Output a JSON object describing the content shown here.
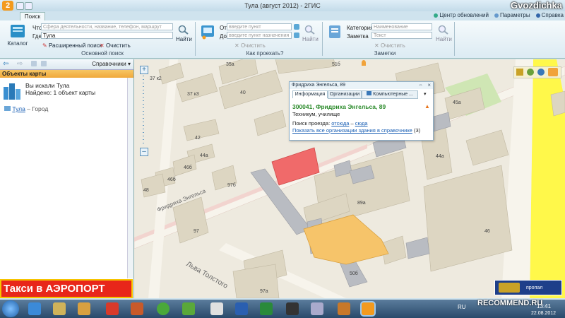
{
  "window": {
    "title": "Тула (август 2012) - 2ГИС",
    "user_watermark": "Gvozdichka",
    "logo_letter": "2"
  },
  "tabs": {
    "search": "Поиск"
  },
  "top_links": {
    "updates": "Центр обновлений",
    "settings": "Параметры",
    "help": "Справка"
  },
  "ribbon": {
    "catalog_label": "Каталог",
    "main_search": {
      "what_label": "Что",
      "what_placeholder": "Сфера деятельности, название, телефон, маршрут",
      "where_label": "Где",
      "where_value": "Тула",
      "find_label": "Найти",
      "advanced_label": "Расширенный поиск",
      "clear_label": "Очистить",
      "group_label": "Основной поиск"
    },
    "route": {
      "from_label": "От",
      "from_placeholder": "введите пункт отправления",
      "to_label": "До",
      "to_placeholder": "введите пункт назначения",
      "clear_label": "Очистить",
      "find_label": "Найти",
      "group_label": "Как проехать?"
    },
    "notes": {
      "category_label": "Категория",
      "category_value": "Наименование",
      "note_label": "Заметка",
      "note_placeholder": "Текст",
      "clear_label": "Очистить",
      "find_label": "Найти",
      "group_label": "Заметки"
    }
  },
  "left_panel": {
    "toolbar_dropdown": "Справочники",
    "header": "Объекты карты",
    "result_line1": "Вы искали Тула",
    "result_line2": "Найдено: 1 объект карты",
    "city_link": "Тула",
    "city_suffix": " – Город",
    "ad_text": "Такси в АЭРОПОРТ"
  },
  "popup": {
    "title": "Фридриха Энгельса, 89",
    "tabs": [
      "Информация",
      "Организации",
      "Компьютерные ..."
    ],
    "address": "300041, Фридриха Энгельса, 89",
    "type": "Техникум, училище",
    "route_label": "Поиск проезда: ",
    "route_from": "отсюда",
    "route_dash": " – ",
    "route_to": "сюда",
    "orgs_link": "Показать все организации здания в справочнике",
    "orgs_count": " (3)"
  },
  "map": {
    "street_name": "Фридриха Энгельса",
    "street_name2": "Льва Толстого",
    "house_labels": [
      "35а",
      "51б",
      "37 к2",
      "37 к3",
      "40",
      "42",
      "44а",
      "46б",
      "48",
      "46б",
      "97б",
      "89а",
      "44а",
      "45а",
      "46",
      "97",
      "97а",
      "50б",
      "56"
    ],
    "ad_missing_person": "пропал человек?"
  },
  "taskbar": {
    "watermark": "RECOMMEND.RU",
    "time": "13:41",
    "date": "22.08.2012",
    "lang": "RU"
  },
  "colors": {
    "highlight_building": "#f06a6a",
    "selected_building": "#f6c46a",
    "ribbon_bg": "#e4eff6",
    "ad_bg": "#e8261a"
  }
}
